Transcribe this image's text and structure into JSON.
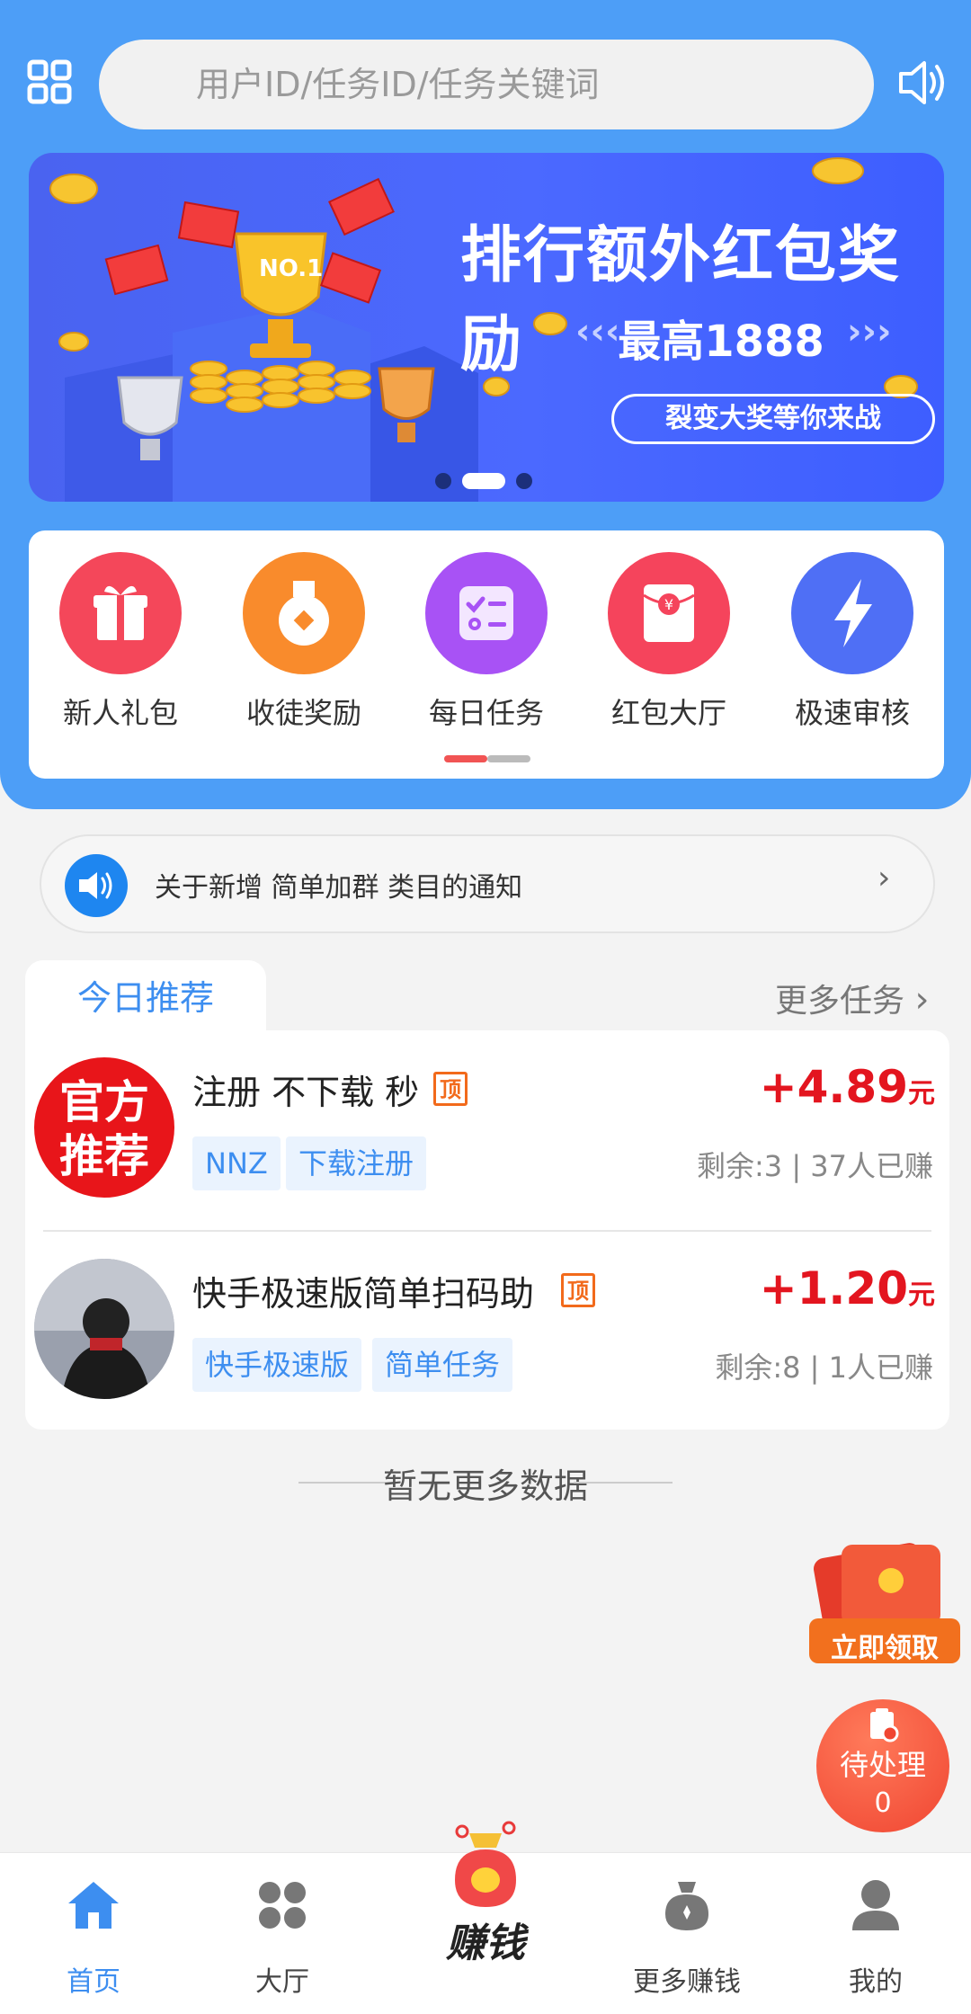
{
  "search": {
    "placeholder": "用户ID/任务ID/任务关键词"
  },
  "banner": {
    "title": "排行额外红包奖励",
    "subtitle": "最高1888",
    "trophy_label": "NO.1",
    "pill": "裂变大奖等你来战",
    "slide_count": 3,
    "active_slide": 1
  },
  "menu": {
    "items": [
      {
        "label": "新人礼包",
        "icon": "gift-icon",
        "color": "#f4475a"
      },
      {
        "label": "收徒奖励",
        "icon": "medal-icon",
        "color": "#f98b2c"
      },
      {
        "label": "每日任务",
        "icon": "checklist-icon",
        "color": "#a852f5"
      },
      {
        "label": "红包大厅",
        "icon": "red-packet-icon",
        "color": "#f5445c"
      },
      {
        "label": "极速审核",
        "icon": "lightning-icon",
        "color": "#4f6ff5"
      }
    ]
  },
  "notice": {
    "text": "关于新增 简单加群 类目的通知",
    "arrow": "›"
  },
  "recommend": {
    "tab_label": "今日推荐",
    "more_label": "更多任务",
    "more_arrow": "›",
    "tasks": [
      {
        "avatar_text_1": "官方",
        "avatar_text_2": "推荐",
        "title": "注册 不下载 秒",
        "badge": "顶",
        "tags": [
          "NNZ",
          "下载注册"
        ],
        "price": "+4.89",
        "unit": "元",
        "meta": "剩余:3 | 37人已赚"
      },
      {
        "title": "快手极速版简单扫码助",
        "badge": "顶",
        "tags": [
          "快手极速版",
          "简单任务"
        ],
        "price": "+1.20",
        "unit": "元",
        "meta": "剩余:8 | 1人已赚"
      }
    ]
  },
  "no_more": "暂无更多数据",
  "floating": {
    "claim_label": "立即领取",
    "pending_label": "待处理",
    "pending_count": "0"
  },
  "nav": {
    "items": [
      {
        "label": "首页",
        "icon": "home-icon",
        "active": true
      },
      {
        "label": "大厅",
        "icon": "grid-icon",
        "active": false
      },
      {
        "label": "赚钱",
        "icon": "money-bag-icon",
        "active": false
      },
      {
        "label": "更多赚钱",
        "icon": "coin-bag-icon",
        "active": false
      },
      {
        "label": "我的",
        "icon": "user-icon",
        "active": false
      }
    ]
  },
  "colors": {
    "primary": "#4d9ef7",
    "accent_blue": "#3d8ef0",
    "price_red": "#e3151f",
    "badge_orange": "#f26a1b"
  }
}
